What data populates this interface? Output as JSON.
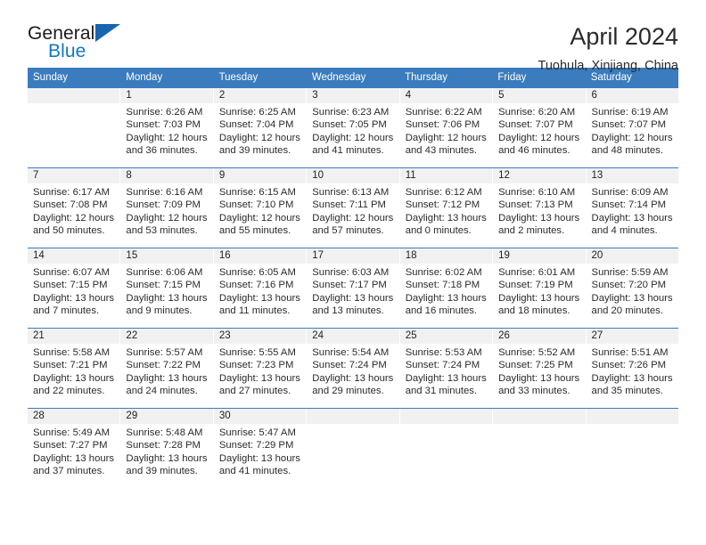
{
  "brand": {
    "name_part1": "General",
    "name_part2": "Blue",
    "flag_icon": "triangle-flag-icon",
    "accent_color": "#1277c4"
  },
  "header": {
    "title": "April 2024",
    "subtitle": "Tuohula, Xinjiang, China"
  },
  "theme": {
    "header_blue": "#3a7cbe",
    "day_band_gray": "#f1f1f1",
    "text_color": "#2b2b2b"
  },
  "calendar": {
    "weekday_headers": [
      "Sunday",
      "Monday",
      "Tuesday",
      "Wednesday",
      "Thursday",
      "Friday",
      "Saturday"
    ],
    "weeks": [
      {
        "numbers": [
          "",
          "1",
          "2",
          "3",
          "4",
          "5",
          "6"
        ],
        "cells": [
          {
            "empty": true,
            "lines": [
              "",
              "",
              "",
              ""
            ]
          },
          {
            "empty": false,
            "lines": [
              "Sunrise: 6:26 AM",
              "Sunset: 7:03 PM",
              "Daylight: 12 hours",
              "and 36 minutes."
            ]
          },
          {
            "empty": false,
            "lines": [
              "Sunrise: 6:25 AM",
              "Sunset: 7:04 PM",
              "Daylight: 12 hours",
              "and 39 minutes."
            ]
          },
          {
            "empty": false,
            "lines": [
              "Sunrise: 6:23 AM",
              "Sunset: 7:05 PM",
              "Daylight: 12 hours",
              "and 41 minutes."
            ]
          },
          {
            "empty": false,
            "lines": [
              "Sunrise: 6:22 AM",
              "Sunset: 7:06 PM",
              "Daylight: 12 hours",
              "and 43 minutes."
            ]
          },
          {
            "empty": false,
            "lines": [
              "Sunrise: 6:20 AM",
              "Sunset: 7:07 PM",
              "Daylight: 12 hours",
              "and 46 minutes."
            ]
          },
          {
            "empty": false,
            "lines": [
              "Sunrise: 6:19 AM",
              "Sunset: 7:07 PM",
              "Daylight: 12 hours",
              "and 48 minutes."
            ]
          }
        ]
      },
      {
        "numbers": [
          "7",
          "8",
          "9",
          "10",
          "11",
          "12",
          "13"
        ],
        "cells": [
          {
            "empty": false,
            "lines": [
              "Sunrise: 6:17 AM",
              "Sunset: 7:08 PM",
              "Daylight: 12 hours",
              "and 50 minutes."
            ]
          },
          {
            "empty": false,
            "lines": [
              "Sunrise: 6:16 AM",
              "Sunset: 7:09 PM",
              "Daylight: 12 hours",
              "and 53 minutes."
            ]
          },
          {
            "empty": false,
            "lines": [
              "Sunrise: 6:15 AM",
              "Sunset: 7:10 PM",
              "Daylight: 12 hours",
              "and 55 minutes."
            ]
          },
          {
            "empty": false,
            "lines": [
              "Sunrise: 6:13 AM",
              "Sunset: 7:11 PM",
              "Daylight: 12 hours",
              "and 57 minutes."
            ]
          },
          {
            "empty": false,
            "lines": [
              "Sunrise: 6:12 AM",
              "Sunset: 7:12 PM",
              "Daylight: 13 hours",
              "and 0 minutes."
            ]
          },
          {
            "empty": false,
            "lines": [
              "Sunrise: 6:10 AM",
              "Sunset: 7:13 PM",
              "Daylight: 13 hours",
              "and 2 minutes."
            ]
          },
          {
            "empty": false,
            "lines": [
              "Sunrise: 6:09 AM",
              "Sunset: 7:14 PM",
              "Daylight: 13 hours",
              "and 4 minutes."
            ]
          }
        ]
      },
      {
        "numbers": [
          "14",
          "15",
          "16",
          "17",
          "18",
          "19",
          "20"
        ],
        "cells": [
          {
            "empty": false,
            "lines": [
              "Sunrise: 6:07 AM",
              "Sunset: 7:15 PM",
              "Daylight: 13 hours",
              "and 7 minutes."
            ]
          },
          {
            "empty": false,
            "lines": [
              "Sunrise: 6:06 AM",
              "Sunset: 7:15 PM",
              "Daylight: 13 hours",
              "and 9 minutes."
            ]
          },
          {
            "empty": false,
            "lines": [
              "Sunrise: 6:05 AM",
              "Sunset: 7:16 PM",
              "Daylight: 13 hours",
              "and 11 minutes."
            ]
          },
          {
            "empty": false,
            "lines": [
              "Sunrise: 6:03 AM",
              "Sunset: 7:17 PM",
              "Daylight: 13 hours",
              "and 13 minutes."
            ]
          },
          {
            "empty": false,
            "lines": [
              "Sunrise: 6:02 AM",
              "Sunset: 7:18 PM",
              "Daylight: 13 hours",
              "and 16 minutes."
            ]
          },
          {
            "empty": false,
            "lines": [
              "Sunrise: 6:01 AM",
              "Sunset: 7:19 PM",
              "Daylight: 13 hours",
              "and 18 minutes."
            ]
          },
          {
            "empty": false,
            "lines": [
              "Sunrise: 5:59 AM",
              "Sunset: 7:20 PM",
              "Daylight: 13 hours",
              "and 20 minutes."
            ]
          }
        ]
      },
      {
        "numbers": [
          "21",
          "22",
          "23",
          "24",
          "25",
          "26",
          "27"
        ],
        "cells": [
          {
            "empty": false,
            "lines": [
              "Sunrise: 5:58 AM",
              "Sunset: 7:21 PM",
              "Daylight: 13 hours",
              "and 22 minutes."
            ]
          },
          {
            "empty": false,
            "lines": [
              "Sunrise: 5:57 AM",
              "Sunset: 7:22 PM",
              "Daylight: 13 hours",
              "and 24 minutes."
            ]
          },
          {
            "empty": false,
            "lines": [
              "Sunrise: 5:55 AM",
              "Sunset: 7:23 PM",
              "Daylight: 13 hours",
              "and 27 minutes."
            ]
          },
          {
            "empty": false,
            "lines": [
              "Sunrise: 5:54 AM",
              "Sunset: 7:24 PM",
              "Daylight: 13 hours",
              "and 29 minutes."
            ]
          },
          {
            "empty": false,
            "lines": [
              "Sunrise: 5:53 AM",
              "Sunset: 7:24 PM",
              "Daylight: 13 hours",
              "and 31 minutes."
            ]
          },
          {
            "empty": false,
            "lines": [
              "Sunrise: 5:52 AM",
              "Sunset: 7:25 PM",
              "Daylight: 13 hours",
              "and 33 minutes."
            ]
          },
          {
            "empty": false,
            "lines": [
              "Sunrise: 5:51 AM",
              "Sunset: 7:26 PM",
              "Daylight: 13 hours",
              "and 35 minutes."
            ]
          }
        ]
      },
      {
        "numbers": [
          "28",
          "29",
          "30",
          "",
          "",
          "",
          ""
        ],
        "cells": [
          {
            "empty": false,
            "lines": [
              "Sunrise: 5:49 AM",
              "Sunset: 7:27 PM",
              "Daylight: 13 hours",
              "and 37 minutes."
            ]
          },
          {
            "empty": false,
            "lines": [
              "Sunrise: 5:48 AM",
              "Sunset: 7:28 PM",
              "Daylight: 13 hours",
              "and 39 minutes."
            ]
          },
          {
            "empty": false,
            "lines": [
              "Sunrise: 5:47 AM",
              "Sunset: 7:29 PM",
              "Daylight: 13 hours",
              "and 41 minutes."
            ]
          },
          {
            "empty": true,
            "lines": [
              "",
              "",
              "",
              ""
            ]
          },
          {
            "empty": true,
            "lines": [
              "",
              "",
              "",
              ""
            ]
          },
          {
            "empty": true,
            "lines": [
              "",
              "",
              "",
              ""
            ]
          },
          {
            "empty": true,
            "lines": [
              "",
              "",
              "",
              ""
            ]
          }
        ]
      }
    ]
  }
}
